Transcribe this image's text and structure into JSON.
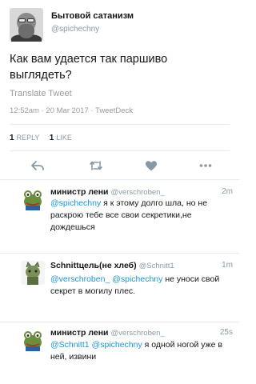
{
  "tweet": {
    "author_name": "Бытовой сатанизм",
    "author_handle": "@spichechny",
    "text": "Как вам удается так паршиво выглядеть?",
    "translate_label": "Translate Tweet",
    "timestamp": "12:52am · 20 Mar 2017",
    "source": "TweetDeck",
    "reply_count": "1",
    "reply_label": "REPLY",
    "like_count": "1",
    "like_label": "LIKE"
  },
  "actions": {
    "icons": [
      "reply-icon",
      "retweet-icon",
      "heart-icon",
      "more-icon"
    ],
    "color": "#8899a6"
  },
  "replies": [
    {
      "name": "министр лени",
      "handle": "@verschroben_",
      "time": "2m",
      "text_parts": [
        {
          "t": "@spichechny",
          "mention": true
        },
        {
          "t": " я к этому долго шла, но не раскрою тебе все свои секретики,не дождешься",
          "mention": false
        }
      ]
    },
    {
      "name": "Schnittцель(не хлеб)",
      "handle": "@Schnitt1",
      "time": "1m",
      "text_parts": [
        {
          "t": "@verschroben_",
          "mention": true
        },
        {
          "t": " ",
          "mention": false
        },
        {
          "t": "@spichechny",
          "mention": true
        },
        {
          "t": " не уноси свой секрет в могилу плес.",
          "mention": false
        }
      ]
    },
    {
      "name": "министр лени",
      "handle": "@verschroben_",
      "time": "25s",
      "text_parts": [
        {
          "t": "@Schnitt1",
          "mention": true
        },
        {
          "t": " ",
          "mention": false
        },
        {
          "t": "@spichechny",
          "mention": true
        },
        {
          "t": " я одной ногой уже в ней, извини",
          "mention": false
        }
      ]
    }
  ],
  "colors": {
    "mention": "#1b95e0",
    "muted": "#8899a6",
    "divider": "#e6ecf0"
  }
}
